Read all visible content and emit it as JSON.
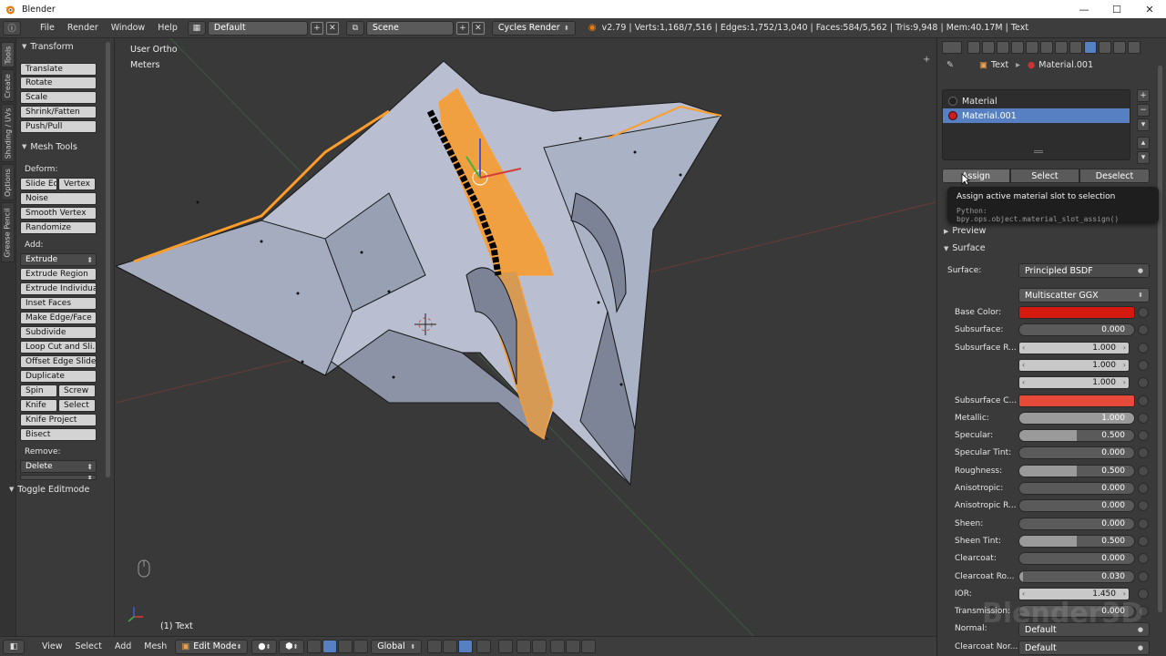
{
  "window": {
    "title": "Blender",
    "minimize": "—",
    "maximize": "☐",
    "close": "✕"
  },
  "topbar": {
    "menu": [
      "File",
      "Render",
      "Window",
      "Help"
    ],
    "layout": "Default",
    "scene": "Scene",
    "engine": "Cycles Render",
    "stats": "v2.79 | Verts:1,168/7,516 | Edges:1,752/13,040 | Faces:584/5,562 | Tris:9,948 | Mem:40.17M | Text"
  },
  "tabs": [
    "Tools",
    "Create",
    "Shading / UVs",
    "Options",
    "Grease Pencil"
  ],
  "toolshelf": {
    "transform_header": "Transform",
    "transform": [
      "Translate",
      "Rotate",
      "Scale",
      "Shrink/Fatten",
      "Push/Pull"
    ],
    "mesh_tools_header": "Mesh Tools",
    "deform_label": "Deform:",
    "deform_pair": [
      "Slide Ed",
      "Vertex"
    ],
    "deform": [
      "Noise",
      "Smooth Vertex",
      "Randomize"
    ],
    "add_label": "Add:",
    "add_dropdown": "Extrude",
    "add": [
      "Extrude Region",
      "Extrude Individual",
      "Inset Faces",
      "Make Edge/Face",
      "Subdivide",
      "Loop Cut and Sli...",
      "Offset Edge Slide",
      "Duplicate"
    ],
    "spin_pair": [
      "Spin",
      "Screw"
    ],
    "knife_pair": [
      "Knife",
      "Select"
    ],
    "more": [
      "Knife Project",
      "Bisect"
    ],
    "remove_label": "Remove:",
    "remove_dropdown": "Delete",
    "toggle_header": "Toggle Editmode"
  },
  "viewport": {
    "view_label": "User Ortho",
    "units_label": "Meters",
    "object_label": "(1) Text"
  },
  "properties": {
    "breadcrumb": [
      "Text",
      "Material.001"
    ],
    "slots": [
      {
        "name": "Material",
        "color": "#2a2a2a"
      },
      {
        "name": "Material.001",
        "color": "#c81e1e"
      }
    ],
    "buttons": [
      "Assign",
      "Select",
      "Deselect"
    ],
    "preview_header": "Preview",
    "surface_header": "Surface",
    "surface_label": "Surface:",
    "surface_value": "Principled BSDF",
    "distribution": "Multiscatter GGX",
    "rows": [
      {
        "label": "Base Color:",
        "type": "color",
        "color": "#d41a0e"
      },
      {
        "label": "Subsurface:",
        "type": "slider",
        "value": "0.000",
        "fill": 0.0
      },
      {
        "label": "Subsurface R...",
        "type": "num",
        "value": "1.000"
      },
      {
        "label": "",
        "type": "num",
        "value": "1.000"
      },
      {
        "label": "",
        "type": "num",
        "value": "1.000"
      },
      {
        "label": "Subsurface C...",
        "type": "color",
        "color": "#e84a3a"
      },
      {
        "label": "Metallic:",
        "type": "slider",
        "value": "1.000",
        "fill": 1.0
      },
      {
        "label": "Specular:",
        "type": "slider",
        "value": "0.500",
        "fill": 0.5
      },
      {
        "label": "Specular Tint:",
        "type": "slider",
        "value": "0.000",
        "fill": 0.0
      },
      {
        "label": "Roughness:",
        "type": "slider",
        "value": "0.500",
        "fill": 0.5
      },
      {
        "label": "Anisotropic:",
        "type": "slider",
        "value": "0.000",
        "fill": 0.0
      },
      {
        "label": "Anisotropic R...",
        "type": "slider",
        "value": "0.000",
        "fill": 0.0
      },
      {
        "label": "Sheen:",
        "type": "slider",
        "value": "0.000",
        "fill": 0.0
      },
      {
        "label": "Sheen Tint:",
        "type": "slider",
        "value": "0.500",
        "fill": 0.5
      },
      {
        "label": "Clearcoat:",
        "type": "slider",
        "value": "0.000",
        "fill": 0.0
      },
      {
        "label": "Clearcoat Ro...",
        "type": "slider",
        "value": "0.030",
        "fill": 0.03
      },
      {
        "label": "IOR:",
        "type": "num",
        "value": "1.450"
      },
      {
        "label": "Transmission:",
        "type": "slider",
        "value": "0.000",
        "fill": 0.0
      },
      {
        "label": "Normal:",
        "type": "dropdown",
        "value": "Default"
      },
      {
        "label": "Clearcoat Nor...",
        "type": "dropdown",
        "value": "Default"
      }
    ]
  },
  "tooltip": {
    "title": "Assign active material slot to selection",
    "python": "Python: bpy.ops.object.material_slot_assign()"
  },
  "bottombar": {
    "menu": [
      "View",
      "Select",
      "Add",
      "Mesh"
    ],
    "mode": "Edit Mode",
    "orientation": "Global"
  },
  "watermark": "Blender3D"
}
